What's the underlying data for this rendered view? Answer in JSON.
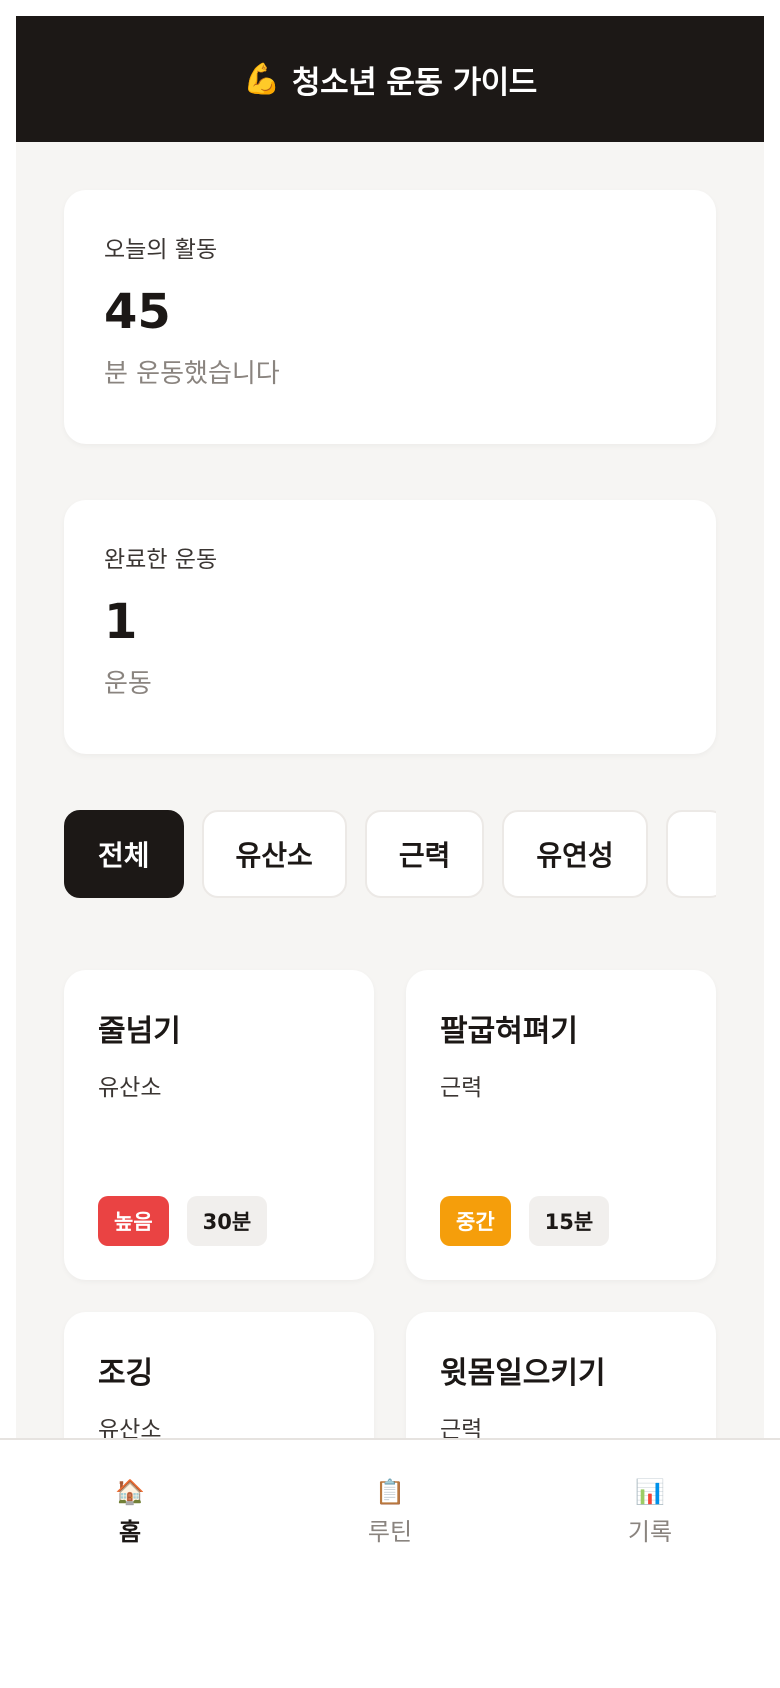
{
  "header": {
    "emoji": "💪",
    "title": "청소년 운동 가이드"
  },
  "stats": [
    {
      "label": "오늘의 활동",
      "value": "45",
      "unit": "분 운동했습니다"
    },
    {
      "label": "완료한 운동",
      "value": "1",
      "unit": "운동"
    }
  ],
  "filters": {
    "items": [
      {
        "label": "전체",
        "active": true
      },
      {
        "label": "유산소"
      },
      {
        "label": "근력"
      },
      {
        "label": "유연성"
      }
    ]
  },
  "exercises": [
    {
      "name": "줄넘기",
      "category": "유산소",
      "level": "높음",
      "level_color": "#ea4343",
      "time": "30분"
    },
    {
      "name": "팔굽혀펴기",
      "category": "근력",
      "level": "중간",
      "level_color": "#f59e0b",
      "time": "15분"
    },
    {
      "name": "조깅",
      "category": "유산소"
    },
    {
      "name": "윗몸일으키기",
      "category": "근력"
    }
  ],
  "nav": {
    "items": [
      {
        "icon": "🏠",
        "icon_name": "home-icon",
        "label": "홈",
        "active": true
      },
      {
        "icon": "📋",
        "icon_name": "clipboard-icon",
        "label": "루틴"
      },
      {
        "icon": "📊",
        "icon_name": "bar-chart-icon",
        "label": "기록"
      }
    ]
  },
  "colors": {
    "header_bg": "#1c1816",
    "high": "#ea4343",
    "medium": "#f59e0b"
  }
}
